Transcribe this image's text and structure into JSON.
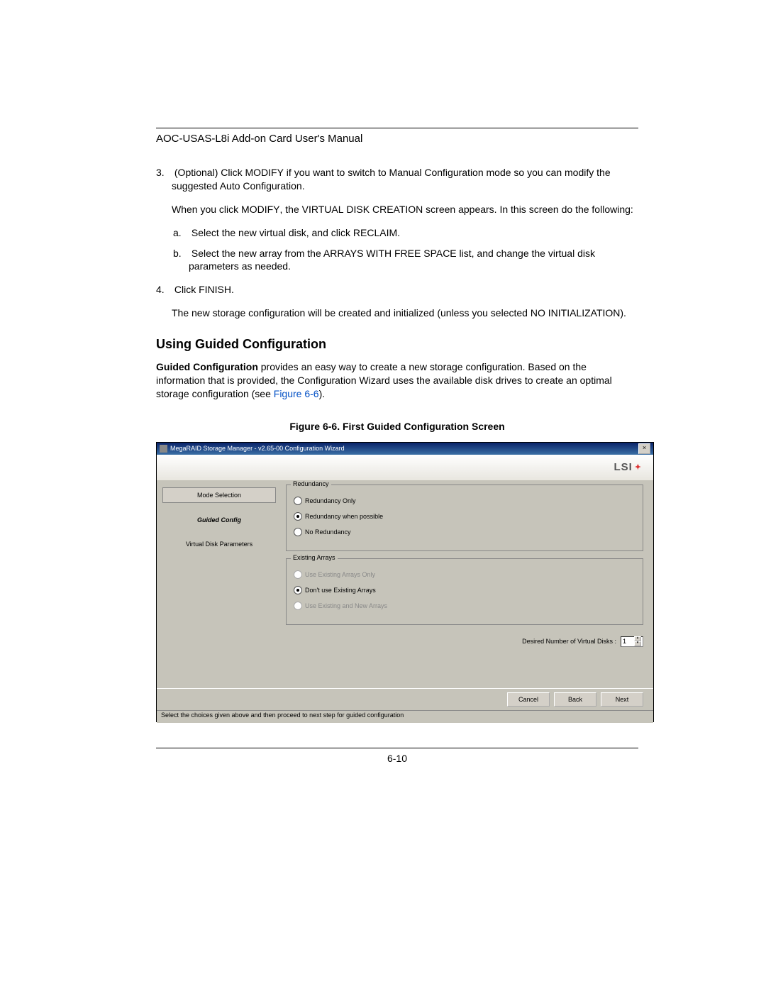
{
  "doc_title": "AOC-USAS-L8i Add-on Card User's Manual",
  "step3": {
    "num": "3.",
    "text_a": "(Optional) Click M",
    "text_b": "ODIFY",
    "text_c": " if you want to switch to Manual Configuration mode so you can modify the suggested Auto Configuration.",
    "para2_a": "When you click M",
    "para2_b": "ODIFY",
    "para2_c": ", the V",
    "para2_d": "IRTUAL",
    "para2_e": " D",
    "para2_f": "ISK",
    "para2_g": " C",
    "para2_h": "REATION",
    "para2_i": " screen appears. In this screen do the following:",
    "sub_a_letter": "a.",
    "sub_a_1": "Select the new virtual disk, and click R",
    "sub_a_2": "ECLAIM",
    "sub_a_3": ".",
    "sub_b_letter": "b.",
    "sub_b_1": "Select the new array from the A",
    "sub_b_2": "RRAYS WITH",
    "sub_b_3": " F",
    "sub_b_4": "REE",
    "sub_b_5": " S",
    "sub_b_6": "PACE",
    "sub_b_7": " list, and change the virtual disk parameters as needed."
  },
  "step4": {
    "num": "4.",
    "text_a": "Click F",
    "text_b": "INISH",
    "text_c": ".",
    "para2_a": "The new storage configuration will be created and initialized (unless you selected N",
    "para2_b": "O",
    "para2_c": " I",
    "para2_d": "NITIALIZATION",
    "para2_e": ")."
  },
  "section_title": "Using Guided Configuration",
  "section_para_a": "Guided Configuration",
  "section_para_b": " provides an easy way to create a new storage configuration. Based on the information that is provided, the Configuration Wizard uses the available disk drives to create an optimal storage configuration (see ",
  "section_para_link": "Figure 6-6",
  "section_para_c": ").",
  "figure_caption": "Figure 6-6. First Guided Configuration Screen",
  "shot": {
    "title": "MegaRAID Storage Manager - v2.65-00 Configuration Wizard",
    "close": "×",
    "logo": "LSI",
    "steps": {
      "mode": "Mode Selection",
      "guided": "Guided Config",
      "vdp": "Virtual Disk Parameters"
    },
    "redundancy": {
      "legend": "Redundancy",
      "opt1": "Redundancy Only",
      "opt2": "Redundancy when possible",
      "opt3": "No Redundancy"
    },
    "arrays": {
      "legend": "Existing Arrays",
      "opt1": "Use Existing Arrays Only",
      "opt2": "Don't use Existing Arrays",
      "opt3": "Use Existing and New Arrays"
    },
    "desired_label": "Desired Number of Virtual Disks :",
    "desired_value": "1",
    "buttons": {
      "cancel": "Cancel",
      "back": "Back",
      "next": "Next"
    },
    "status": "Select the choices given above and then proceed to next step for guided configuration"
  },
  "page_num": "6-10"
}
